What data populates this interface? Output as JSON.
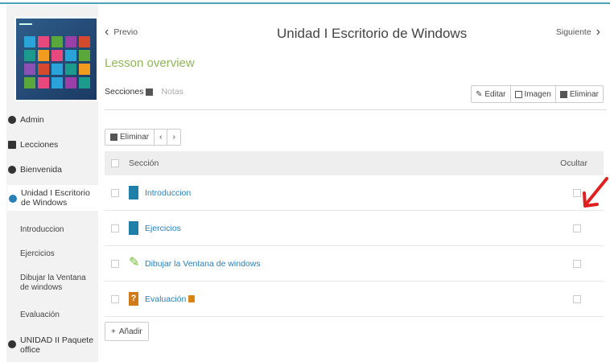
{
  "nav": {
    "prev_label": "Previo",
    "unit_title": "Unidad I Escritorio de Windows",
    "next_label": "Siguiente"
  },
  "overview_label": "Lesson overview",
  "tabs": {
    "sections": "Secciones",
    "notes": "Notas"
  },
  "actions": {
    "edit": "Editar",
    "image": "Imagen",
    "delete": "Eliminar"
  },
  "toolbar": {
    "delete": "Eliminar",
    "prev": "‹",
    "next": "›"
  },
  "table": {
    "col_section": "Sección",
    "col_hide": "Ocultar",
    "rows": [
      {
        "label": "Introduccion",
        "icon": "document-icon",
        "color": "#1f7fa8"
      },
      {
        "label": "Ejercicios",
        "icon": "document-icon",
        "color": "#1f7fa8"
      },
      {
        "label": "Dibujar la Ventana de windows",
        "icon": "pencil-icon",
        "color": "#6cbf2a"
      },
      {
        "label": "Evaluación",
        "icon": "quiz-icon",
        "color": "#d07a1a",
        "locked": true
      }
    ]
  },
  "add_label": "Añadir",
  "sidebar": {
    "admin": "Admin",
    "lessons": "Lecciones",
    "welcome": "Bienvenida",
    "unit1": "Unidad I Escritorio de Windows",
    "subitems": [
      "Introduccion",
      "Ejercicios",
      "Dibujar la Ventana de windows",
      "Evaluación"
    ],
    "unit2": "UNIDAD II Paquete office"
  },
  "colors": {
    "accent": "#2a7fb8",
    "overview_green": "#8fb65a",
    "arrow_red": "#e02020"
  }
}
